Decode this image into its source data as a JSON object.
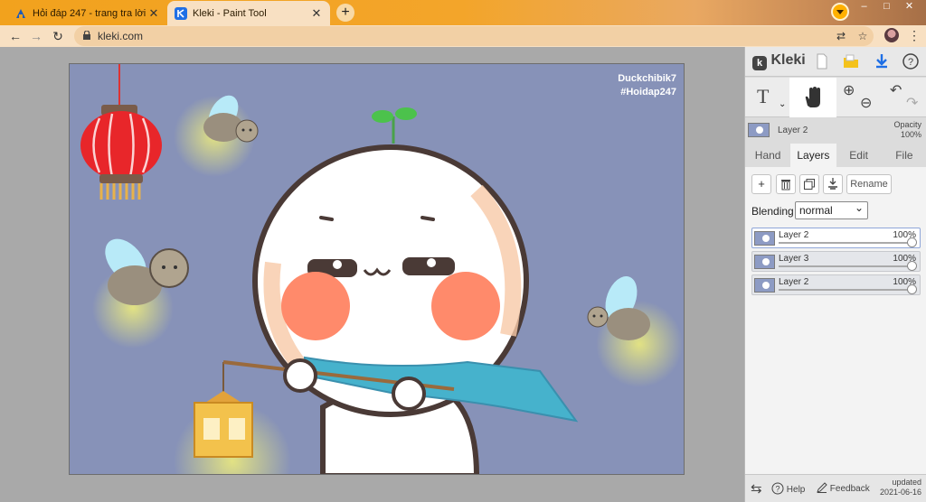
{
  "browser": {
    "tabs": [
      {
        "title": "Hỏi đáp 247 - trang tra lời",
        "favicon": "hoidap-favicon-icon",
        "active": false
      },
      {
        "title": "Kleki - Paint Tool",
        "favicon": "kleki-favicon-icon",
        "active": true
      }
    ],
    "new_tab_label": "+",
    "window": {
      "minimize": "–",
      "maximize": "□",
      "close": "✕"
    },
    "address": "kleki.com",
    "nav": {
      "back": "←",
      "forward": "→",
      "reload": "↻"
    },
    "tab_close": "✕",
    "kebab": "⋮",
    "star": "☆",
    "translate": "⇄"
  },
  "canvas": {
    "credit_line1": "Duckchibik7",
    "credit_line2": "#Hoidap247",
    "background_color": "#8792b8"
  },
  "sidebar": {
    "logo": "Kleki",
    "tool_text": "T",
    "zoom_in": "⊕",
    "zoom_out": "⊖",
    "undo": "↶",
    "redo": "↷",
    "current_layer": "Layer 2",
    "opacity_label": "Opacity",
    "opacity_value": "100%",
    "tabs": [
      "Hand",
      "Layers",
      "Edit",
      "File"
    ],
    "active_tab": "Layers",
    "buttons": {
      "add": "+",
      "delete": "🗑",
      "duplicate": "⧉",
      "merge": "⤓",
      "rename": "Rename"
    },
    "blending_label": "Blending",
    "blending_value": "normal",
    "layers": [
      {
        "name": "Layer 2",
        "opacity": "100%",
        "selected": true
      },
      {
        "name": "Layer 3",
        "opacity": "100%",
        "selected": false
      },
      {
        "name": "Layer 2",
        "opacity": "100%",
        "selected": false
      }
    ],
    "footer": {
      "swap": "⇆",
      "help": "Help",
      "feedback": "Feedback",
      "updated_label": "updated",
      "updated_date": "2021-06-16"
    }
  }
}
